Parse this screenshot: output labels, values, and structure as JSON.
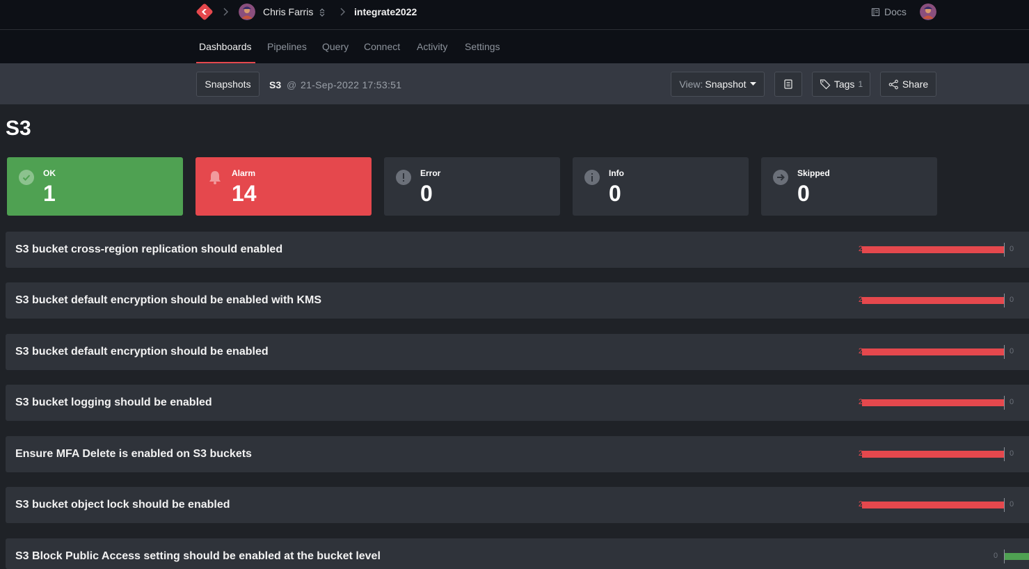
{
  "breadcrumb": {
    "user": "Chris Farris",
    "workspace": "integrate2022"
  },
  "header": {
    "docs_label": "Docs"
  },
  "nav": {
    "tabs": [
      {
        "label": "Dashboards",
        "active": true
      },
      {
        "label": "Pipelines",
        "active": false
      },
      {
        "label": "Query",
        "active": false
      },
      {
        "label": "Connect",
        "active": false
      },
      {
        "label": "Activity",
        "active": false
      },
      {
        "label": "Settings",
        "active": false
      }
    ]
  },
  "toolbar": {
    "snapshots_label": "Snapshots",
    "snapshot_title": "S3",
    "at_symbol": "@",
    "snapshot_time": "21-Sep-2022 17:53:51",
    "view_prefix": "View:",
    "view_value": "Snapshot",
    "tags_label": "Tags",
    "tags_count": "1",
    "share_label": "Share"
  },
  "page": {
    "title": "S3"
  },
  "summary": {
    "ok": {
      "label": "OK",
      "value": "1"
    },
    "alarm": {
      "label": "Alarm",
      "value": "14"
    },
    "error": {
      "label": "Error",
      "value": "0"
    },
    "info": {
      "label": "Info",
      "value": "0"
    },
    "skipped": {
      "label": "Skipped",
      "value": "0"
    }
  },
  "colors": {
    "ok": "#4fa152",
    "alarm": "#e5484d",
    "background": "#1f2227",
    "panel": "#2f333a"
  },
  "controls": [
    {
      "title": "S3 bucket cross-region replication should enabled",
      "alarm": "2",
      "ok": "0"
    },
    {
      "title": "S3 bucket default encryption should be enabled with KMS",
      "alarm": "2",
      "ok": "0"
    },
    {
      "title": "S3 bucket default encryption should be enabled",
      "alarm": "2",
      "ok": "0"
    },
    {
      "title": "S3 bucket logging should be enabled",
      "alarm": "2",
      "ok": "0"
    },
    {
      "title": "Ensure MFA Delete is enabled on S3 buckets",
      "alarm": "2",
      "ok": "0"
    },
    {
      "title": "S3 bucket object lock should be enabled",
      "alarm": "2",
      "ok": "0"
    },
    {
      "title": "S3 Block Public Access setting should be enabled at the bucket level",
      "alarm": "0",
      "ok": ""
    }
  ]
}
